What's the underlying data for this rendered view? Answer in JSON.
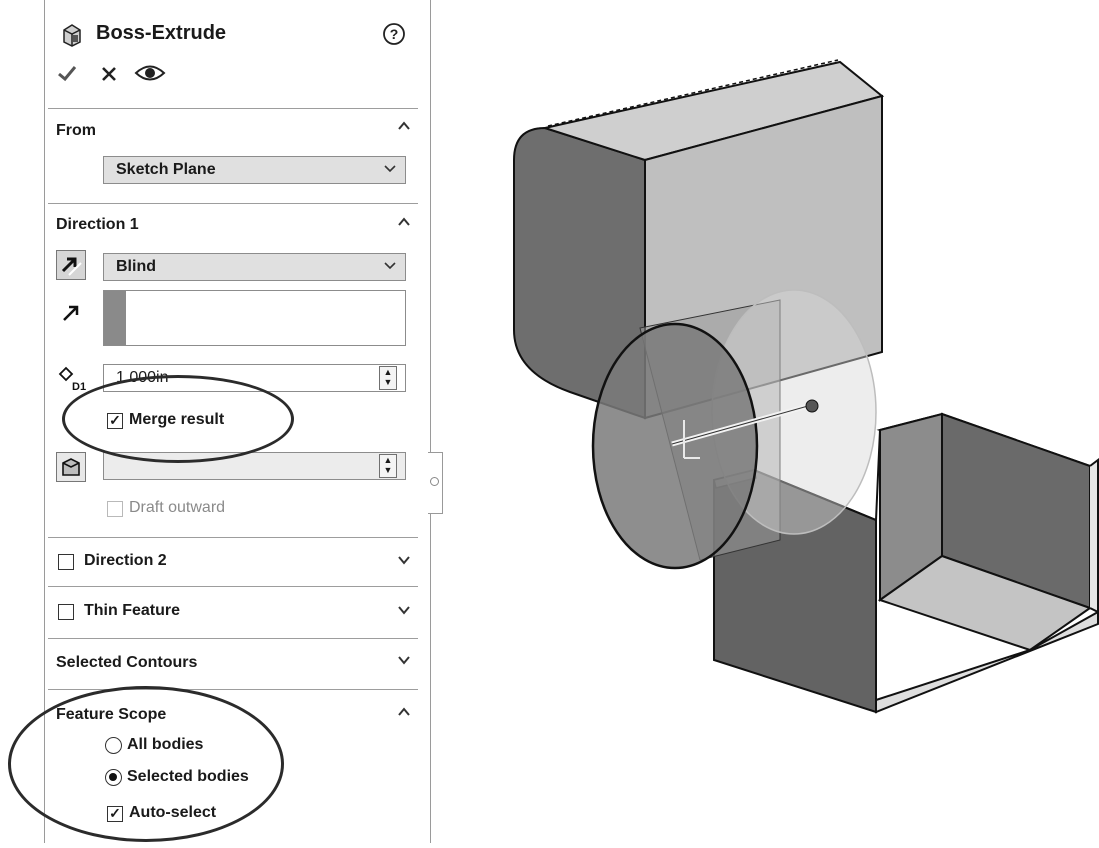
{
  "header": {
    "title": "Boss-Extrude",
    "help_icon": "help-icon",
    "ok_icon": "checkmark-icon",
    "cancel_icon": "close-icon",
    "preview_icon": "eye-icon"
  },
  "from": {
    "title": "From",
    "value": "Sketch Plane"
  },
  "direction1": {
    "title": "Direction 1",
    "end_condition": "Blind",
    "depth": "1.000in",
    "merge_label": "Merge result",
    "merge_checked": true,
    "draft_label": "Draft outward"
  },
  "direction2": {
    "title": "Direction 2"
  },
  "thin": {
    "title": "Thin Feature"
  },
  "contours": {
    "title": "Selected Contours"
  },
  "scope": {
    "title": "Feature Scope",
    "opt_all": "All bodies",
    "opt_selected": "Selected bodies",
    "selected": "Selected bodies",
    "auto_select": "Auto-select"
  },
  "colors": {
    "accent": "#8a8a8a",
    "panel_border": "#9a9a9a"
  }
}
